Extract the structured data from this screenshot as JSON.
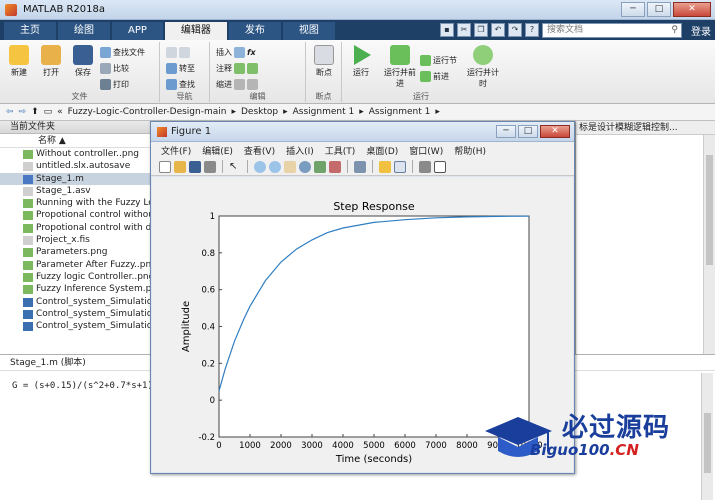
{
  "window": {
    "title": "MATLAB R2018a",
    "min": "─",
    "max": "□",
    "close": "✕"
  },
  "tabs": [
    {
      "label": "主页"
    },
    {
      "label": "绘图"
    },
    {
      "label": "APP"
    },
    {
      "label": "编辑器"
    },
    {
      "label": "发布"
    },
    {
      "label": "视图"
    }
  ],
  "search": {
    "placeholder": "搜索文档"
  },
  "login": "登录",
  "ribbon": {
    "file_group": {
      "label": "文件",
      "new": "新建",
      "open": "打开",
      "save": "保存",
      "find_files": "查找文件",
      "compare": "比较",
      "print": "打印"
    },
    "nav_group": {
      "label": "导航",
      "goto": "转至",
      "find": "查找"
    },
    "edit_group": {
      "label": "编辑",
      "insert": "插入",
      "comment": "注释",
      "indent": "缩进",
      "fx": "fx"
    },
    "breakpoint_group": {
      "label": "断点",
      "breakpoint": "断点"
    },
    "run_group": {
      "label": "运行",
      "run": "运行",
      "run_advance": "运行并前进",
      "run_section": "运行节",
      "advance": "前进",
      "run_time": "运行并计时"
    }
  },
  "address": {
    "path": [
      "«",
      "Fuzzy-Logic-Controller-Design-main",
      "▸",
      "Desktop",
      "▸",
      "Assignment 1",
      "▸",
      "Assignment 1",
      "▸"
    ]
  },
  "current_folder": {
    "title": "当前文件夹",
    "column_name": "名称 ▲",
    "files": [
      {
        "name": "Without controller..png",
        "type": "png"
      },
      {
        "name": "untitled.slx.autosave",
        "type": "file"
      },
      {
        "name": "Stage_1.m",
        "type": "m"
      },
      {
        "name": "Stage_1.asv",
        "type": "file"
      },
      {
        "name": "Running with the Fuzzy Log",
        "type": "png"
      },
      {
        "name": "Propotional control without",
        "type": "png"
      },
      {
        "name": "Propotional control with di",
        "type": "png"
      },
      {
        "name": "Project_x.fis",
        "type": "file"
      },
      {
        "name": "Parameters.png",
        "type": "png"
      },
      {
        "name": "Parameter After Fuzzy..png",
        "type": "png"
      },
      {
        "name": "Fuzzy logic Controller..png",
        "type": "png"
      },
      {
        "name": "Fuzzy Inference System.png",
        "type": "png"
      },
      {
        "name": "Control_system_Simulation",
        "type": "slx"
      },
      {
        "name": "Control_system_Simulation",
        "type": "slx"
      },
      {
        "name": "Control_system_Simulation",
        "type": "slx"
      }
    ]
  },
  "right_panel": {
    "header": "标是设计模糊逻辑控制..."
  },
  "details": {
    "title": "Stage_1.m  (脚本)",
    "code": "G = (s+0.15)/(s^2+0.7*s+1)"
  },
  "figure": {
    "title": "Figure 1",
    "menu": [
      "文件(F)",
      "编辑(E)",
      "查看(V)",
      "插入(I)",
      "工具(T)",
      "桌面(D)",
      "窗口(W)",
      "帮助(H)"
    ]
  },
  "chart_data": {
    "type": "line",
    "title": "Step Response",
    "xlabel": "Time (seconds)",
    "ylabel": "Amplitude",
    "xlim": [
      0,
      10000
    ],
    "ylim": [
      -0.2,
      1
    ],
    "xticks": [
      0,
      1000,
      2000,
      3000,
      4000,
      5000,
      6000,
      7000,
      8000,
      9000,
      10000
    ],
    "yticks": [
      -0.2,
      0,
      0.2,
      0.4,
      0.6,
      0.8,
      1
    ],
    "series": [
      {
        "color": "#2f7ec2",
        "x": [
          0,
          200,
          500,
          800,
          1000,
          1500,
          2000,
          2500,
          3000,
          3500,
          4000,
          5000,
          6000,
          7000,
          8000,
          9000,
          10000
        ],
        "y": [
          0.05,
          0.17,
          0.32,
          0.44,
          0.51,
          0.65,
          0.75,
          0.82,
          0.87,
          0.91,
          0.935,
          0.965,
          0.98,
          0.99,
          0.995,
          0.998,
          0.999
        ]
      }
    ]
  },
  "watermark": {
    "line1": "必过源码",
    "line2": "Biguo100",
    "line2_suffix": ".CN"
  }
}
